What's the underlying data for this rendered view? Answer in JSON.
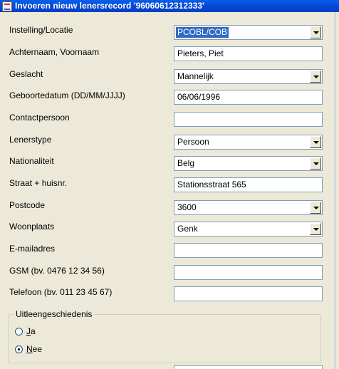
{
  "window": {
    "title": "Invoeren nieuw lenersrecord '96060612312333'"
  },
  "form": {
    "instelling": {
      "label": "Instelling/Locatie",
      "value": "PCOBL/COB"
    },
    "naam": {
      "label": "Achternaam, Voornaam",
      "value": "Pieters, Piet"
    },
    "geslacht": {
      "label": "Geslacht",
      "value": "Mannelijk"
    },
    "geboortedatum": {
      "label": "Geboortedatum (DD/MM/JJJJ)",
      "value": "06/06/1996"
    },
    "contactpersoon": {
      "label": "Contactpersoon",
      "value": ""
    },
    "lenerstype": {
      "label": "Lenerstype",
      "value": "Persoon"
    },
    "nationaliteit": {
      "label": "Nationaliteit",
      "value": "Belg"
    },
    "straat": {
      "label": "Straat + huisnr.",
      "value": "Stationsstraat 565"
    },
    "postcode": {
      "label": "Postcode",
      "value": "3600"
    },
    "woonplaats": {
      "label": "Woonplaats",
      "value": "Genk"
    },
    "email": {
      "label": "E-mailadres",
      "value": ""
    },
    "gsm": {
      "label": "GSM (bv. 0476 12 34 56)",
      "value": ""
    },
    "telefoon": {
      "label": "Telefoon (bv. 011 23 45 67)",
      "value": ""
    }
  },
  "uitleengeschiedenis": {
    "legend": "Uitleengeschiedenis",
    "options": [
      {
        "label": "Ja",
        "checked": false
      },
      {
        "label": "Nee",
        "checked": true
      }
    ]
  },
  "colors": {
    "titlebar": "#0046d5",
    "window_bg": "#ece9d8",
    "field_border": "#7f9db9",
    "selection": "#316ac5"
  }
}
